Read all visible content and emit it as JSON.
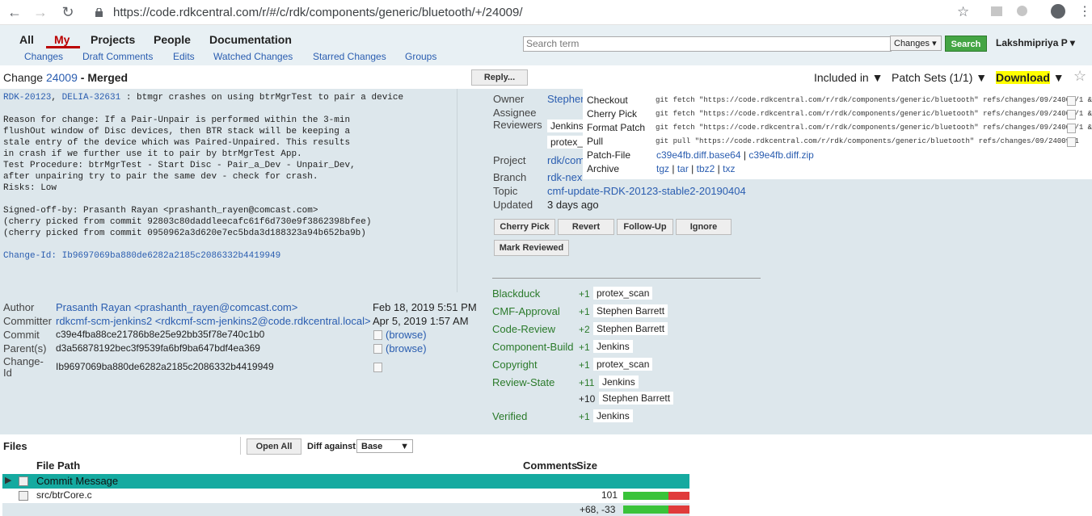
{
  "browser": {
    "url": "https://code.rdkcentral.com/r/#/c/rdk/components/generic/bluetooth/+/24009/"
  },
  "nav": {
    "all": "All",
    "my": "My",
    "projects": "Projects",
    "people": "People",
    "documentation": "Documentation",
    "sub": [
      "Changes",
      "Draft Comments",
      "Edits",
      "Watched Changes",
      "Starred Changes",
      "Groups"
    ],
    "search_placeholder": "Search term",
    "search_type": "Changes",
    "search_button": "Search",
    "user": "Lakshmipriya P"
  },
  "change": {
    "label": "Change",
    "number": "24009",
    "status": "- Merged",
    "reply": "Reply...",
    "included_in": "Included in ▼",
    "patch_sets": "Patch Sets (1/1) ▼",
    "download": "Download",
    "download_arrow": "▼"
  },
  "commit_message": {
    "links": [
      "RDK-20123",
      "DELIA-32631"
    ],
    "subject": " : btmgr crashes on using btrMgrTest to pair a device",
    "body": "Reason for change: If a Pair-Unpair is performed within the 3-min\nflushOut window of Disc devices, then BTR stack will be keeping a\nstale entry of the device which was Paired-Unpaired. This results\nin crash if we further use it to pair by btrMgrTest App.\nTest Procedure: btrMgrTest - Start Disc - Pair_a_Dev - Unpair_Dev,\nafter unpairing try to pair the same dev - check for crash.\nRisks: Low\n\nSigned-off-by: Prasanth Rayan <prashanth_rayen@comcast.com>\n(cherry picked from commit 92803c80daddleecafc61f6d730e9f3862398bfee)\n(cherry picked from commit 0950962a3d620e7ec5bda3d188323a94b652ba9b)",
    "change_id": "Change-Id: Ib9697069ba880de6282a2185c2086332b4419949"
  },
  "commit_info": {
    "author_label": "Author",
    "author": "Prasanth Rayan <prashanth_rayen@comcast.com>",
    "author_date": "Feb 18, 2019 5:51 PM",
    "committer_label": "Committer",
    "committer": "rdkcmf-scm-jenkins2 <rdkcmf-scm-jenkins2@code.rdkcentral.local>",
    "committer_date": "Apr 5, 2019 1:57 AM",
    "commit_label": "Commit",
    "commit": "c39e4fba88ce21786b8e25e92bb35f78e740c1b0",
    "parents_label": "Parent(s)",
    "parent": "d3a56878192bec3f9539fa6bf9ba647bdf4ea369",
    "changeid_label": "Change-\nId",
    "changeid": "Ib9697069ba880de6282a2185c2086332b4419949",
    "browse": "(browse)"
  },
  "meta": {
    "owner_label": "Owner",
    "owner": "Stephen",
    "assignee_label": "Assignee",
    "reviewers_label": "Reviewers",
    "reviewers": [
      "Jenkins",
      "protex_"
    ],
    "project_label": "Project",
    "project": "rdk/com",
    "branch_label": "Branch",
    "branch": "rdk-nex",
    "topic_label": "Topic",
    "topic": "cmf-update-RDK-20123-stable2-20190404",
    "updated_label": "Updated",
    "updated": "3 days ago"
  },
  "actions": [
    "Cherry Pick",
    "Revert",
    "Follow-Up",
    "Ignore",
    "Mark Reviewed"
  ],
  "labels": [
    {
      "name": "Blackduck",
      "votes": [
        {
          "score": "+1",
          "who": "protex_scan"
        }
      ]
    },
    {
      "name": "CMF-Approval",
      "votes": [
        {
          "score": "+1",
          "who": "Stephen Barrett"
        }
      ]
    },
    {
      "name": "Code-Review",
      "votes": [
        {
          "score": "+2",
          "who": "Stephen Barrett"
        }
      ]
    },
    {
      "name": "Component-Build",
      "votes": [
        {
          "score": "+1",
          "who": "Jenkins"
        }
      ]
    },
    {
      "name": "Copyright",
      "votes": [
        {
          "score": "+1",
          "who": "protex_scan"
        }
      ]
    },
    {
      "name": "Review-State",
      "votes": [
        {
          "score": "+11",
          "who": "Jenkins"
        },
        {
          "score": "+10",
          "who": "Stephen Barrett"
        }
      ]
    },
    {
      "name": "Verified",
      "votes": [
        {
          "score": "+1",
          "who": "Jenkins"
        }
      ]
    }
  ],
  "download_popup": {
    "rows": [
      {
        "label": "Checkout",
        "cmd": "git fetch \"https://code.rdkcentral.com/r/rdk/components/generic/bluetooth\" refs/changes/09/24009/1 && ..."
      },
      {
        "label": "Cherry Pick",
        "cmd": "git fetch \"https://code.rdkcentral.com/r/rdk/components/generic/bluetooth\" refs/changes/09/24009/1 && ..."
      },
      {
        "label": "Format Patch",
        "cmd": "git fetch \"https://code.rdkcentral.com/r/rdk/components/generic/bluetooth\" refs/changes/09/24009/1 && ..."
      },
      {
        "label": "Pull",
        "cmd": "git pull \"https://code.rdkcentral.com/r/rdk/components/generic/bluetooth\" refs/changes/09/24009/1"
      }
    ],
    "patch_file_label": "Patch-File",
    "patch_files": [
      "c39e4fb.diff.base64",
      "c39e4fb.diff.zip"
    ],
    "archive_label": "Archive",
    "archives": [
      "tgz",
      "tar",
      "tbz2",
      "txz"
    ]
  },
  "files": {
    "title": "Files",
    "open_all": "Open All",
    "diff_against_label": "Diff against:",
    "diff_against": "Base",
    "col_path": "File Path",
    "col_comments": "Comments",
    "col_size": "Size",
    "rows": [
      {
        "path": "Commit Message",
        "size": "",
        "added_frac": 0,
        "removed_frac": 0
      },
      {
        "path": "src/btrCore.c",
        "size": "101",
        "added_frac": 0.68,
        "removed_frac": 0.32
      }
    ],
    "total": "+68, -33",
    "colors": {
      "added": "#3ac33a",
      "removed": "#e03b3b",
      "selected_row": "#15aaa0"
    }
  }
}
